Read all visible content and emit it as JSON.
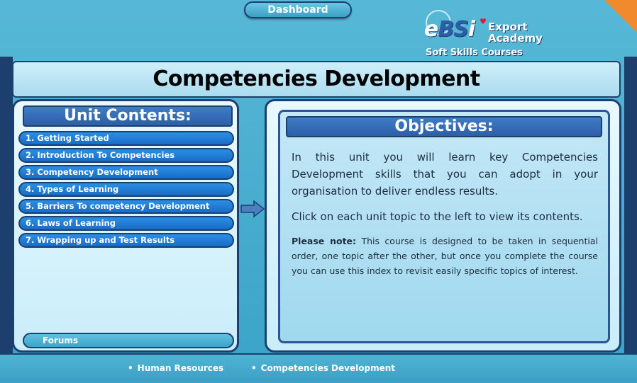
{
  "header": {
    "dashboard_label": "Dashboard",
    "logo": {
      "brand_prefix": "e",
      "brand_mid": "BS",
      "brand_suffix": "i",
      "line1": "Export",
      "line2": "Academy",
      "subtitle": "Soft Skills Courses"
    }
  },
  "title": "Competencies Development",
  "unit_contents": {
    "heading": "Unit Contents:",
    "items": [
      "1. Getting Started",
      "2. Introduction To Competencies",
      "3. Competency Development",
      "4. Types of Learning",
      "5. Barriers To competency Development",
      "6. Laws of Learning",
      "7. Wrapping up and Test Results"
    ],
    "forums_label": "Forums"
  },
  "objectives": {
    "heading": "Objectives:",
    "para1": "In this unit you will learn key Competencies Development skills that you can adopt in your organisation to deliver endless results.",
    "para2": "Click on each unit topic to the left to view its contents.",
    "note_label": "Please note:",
    "note_text": " This course is designed to be taken in sequential order, one topic after the other, but once you complete the course you can use this index to revisit easily specific topics of interest."
  },
  "footer": {
    "links": [
      "Human Resources",
      "Competencies Development"
    ]
  },
  "colors": {
    "accent_orange": "#f08a2c",
    "navy": "#1d3f6e",
    "item_blue": "#1a6cc4"
  }
}
